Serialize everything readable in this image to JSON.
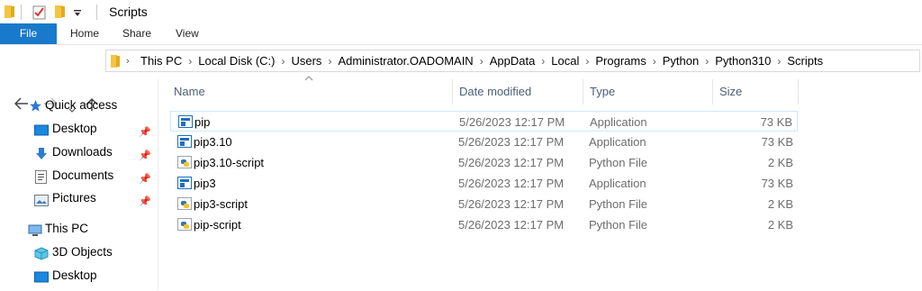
{
  "window": {
    "title": "Scripts"
  },
  "ribbon": {
    "tabs": [
      "File",
      "Home",
      "Share",
      "View"
    ]
  },
  "address": {
    "crumbs": [
      "This PC",
      "Local Disk (C:)",
      "Users",
      "Administrator.OADOMAIN",
      "AppData",
      "Local",
      "Programs",
      "Python",
      "Python310",
      "Scripts"
    ]
  },
  "nav": {
    "quick_access": "Quick access",
    "items": [
      {
        "label": "Desktop",
        "pinned": true,
        "icon": "desktop-icon"
      },
      {
        "label": "Downloads",
        "pinned": true,
        "icon": "download-icon"
      },
      {
        "label": "Documents",
        "pinned": true,
        "icon": "documents-icon"
      },
      {
        "label": "Pictures",
        "pinned": true,
        "icon": "pictures-icon"
      }
    ],
    "this_pc": "This PC",
    "pc_items": [
      {
        "label": "3D Objects",
        "icon": "3d-objects-icon"
      },
      {
        "label": "Desktop",
        "icon": "desktop-icon"
      }
    ]
  },
  "columns": {
    "name": "Name",
    "date": "Date modified",
    "type": "Type",
    "size": "Size"
  },
  "files": [
    {
      "name": "pip",
      "date": "5/26/2023 12:17 PM",
      "type": "Application",
      "size": "73 KB",
      "icon": "application-icon",
      "selected": true
    },
    {
      "name": "pip3.10",
      "date": "5/26/2023 12:17 PM",
      "type": "Application",
      "size": "73 KB",
      "icon": "application-icon"
    },
    {
      "name": "pip3.10-script",
      "date": "5/26/2023 12:17 PM",
      "type": "Python File",
      "size": "2 KB",
      "icon": "python-file-icon"
    },
    {
      "name": "pip3",
      "date": "5/26/2023 12:17 PM",
      "type": "Application",
      "size": "73 KB",
      "icon": "application-icon"
    },
    {
      "name": "pip3-script",
      "date": "5/26/2023 12:17 PM",
      "type": "Python File",
      "size": "2 KB",
      "icon": "python-file-icon"
    },
    {
      "name": "pip-script",
      "date": "5/26/2023 12:17 PM",
      "type": "Python File",
      "size": "2 KB",
      "icon": "python-file-icon"
    }
  ],
  "colors": {
    "accent": "#1979ca",
    "folder": "#f4c542",
    "header_text": "#4c607a"
  }
}
